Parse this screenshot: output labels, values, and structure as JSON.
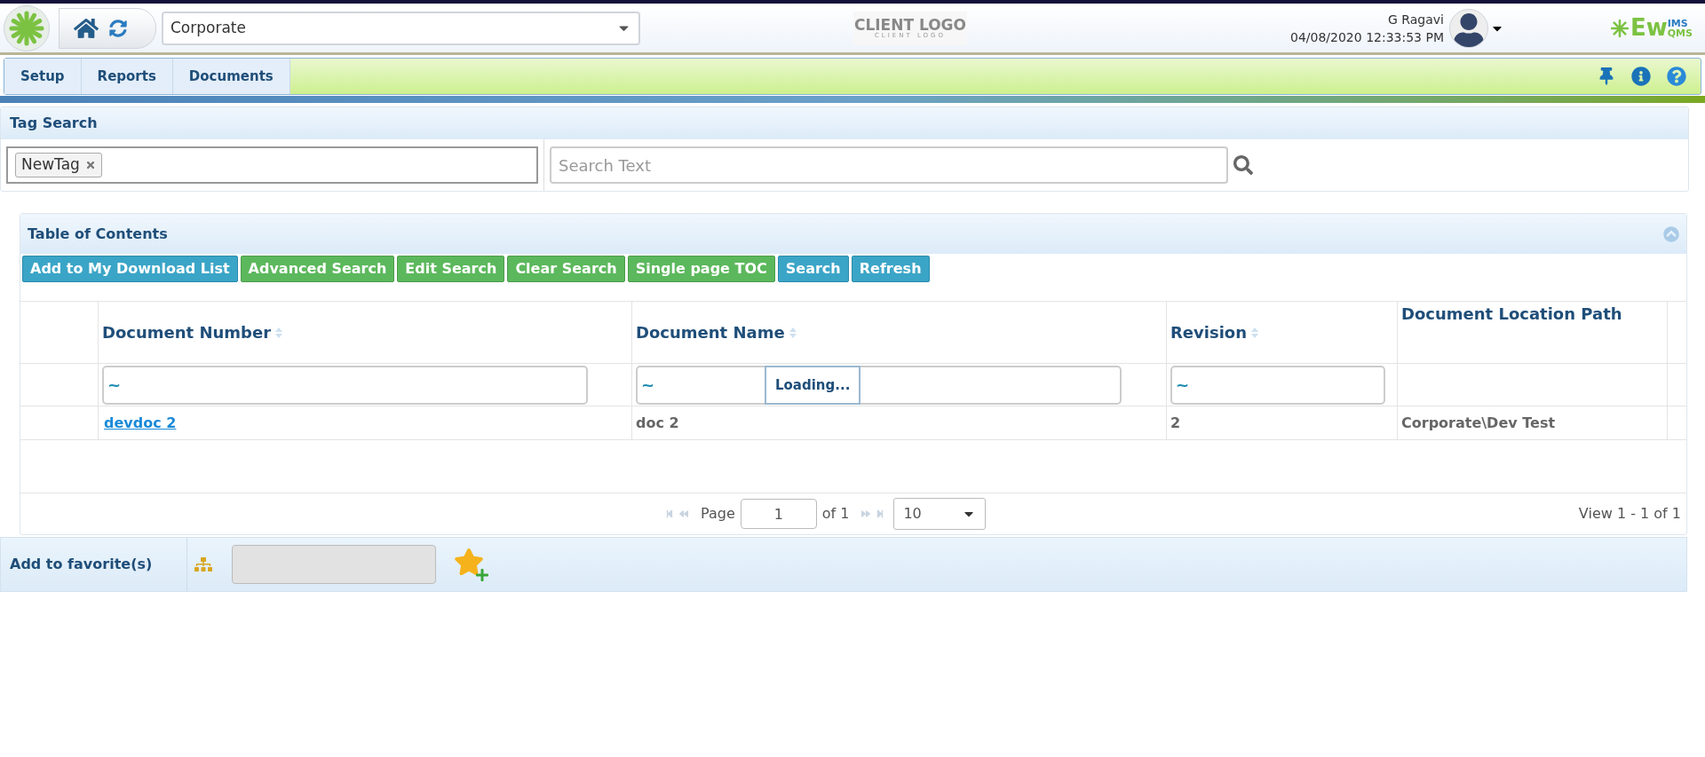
{
  "header": {
    "org_select": "Corporate",
    "client_logo": {
      "title": "CLIENT LOGO",
      "subtitle": "CLIENT LOGO"
    },
    "user_name": "G Ragavi",
    "datetime": "04/08/2020 12:33:53 PM",
    "brand": {
      "main": "Ew",
      "top": "IMS",
      "bottom": "QMS"
    }
  },
  "nav": {
    "tabs": [
      {
        "label": "Setup",
        "selected": false
      },
      {
        "label": "Reports",
        "selected": false
      },
      {
        "label": "Documents",
        "selected": false
      }
    ]
  },
  "tag_search": {
    "title": "Tag Search",
    "tags": [
      "NewTag"
    ],
    "search_placeholder": "Search Text"
  },
  "toc": {
    "title": "Table of Contents",
    "buttons": [
      {
        "label": "Add to My Download List",
        "kind": "blue"
      },
      {
        "label": "Advanced Search",
        "kind": "green"
      },
      {
        "label": "Edit Search",
        "kind": "green"
      },
      {
        "label": "Clear Search",
        "kind": "green"
      },
      {
        "label": "Single page TOC",
        "kind": "green"
      },
      {
        "label": "Search",
        "kind": "blue"
      },
      {
        "label": "Refresh",
        "kind": "blue"
      }
    ],
    "columns": [
      {
        "label": "Document Number",
        "sortable": true,
        "filter": "~"
      },
      {
        "label": "Document Name",
        "sortable": true,
        "filter": "~"
      },
      {
        "label": "Revision",
        "sortable": true,
        "filter": "~"
      },
      {
        "label": "Document Location Path",
        "sortable": false
      }
    ],
    "loading": "Loading...",
    "rows": [
      {
        "number": "devdoc 2",
        "name": "doc 2",
        "revision": "2",
        "path": "Corporate\\Dev Test"
      }
    ],
    "pager": {
      "page_label": "Page",
      "page": "1",
      "of": "of 1",
      "page_size": "10",
      "summary": "View 1 - 1 of 1"
    }
  },
  "favorites": {
    "label": "Add to favorite(s)"
  }
}
